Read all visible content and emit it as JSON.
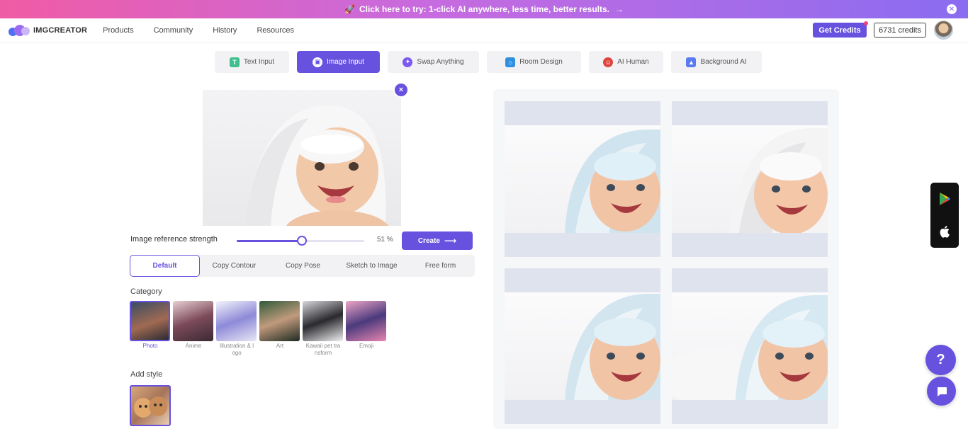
{
  "banner": {
    "text": "Click here to try: 1-click AI anywhere, less time, better results.",
    "arrow": "→",
    "close": "✕"
  },
  "nav": {
    "logo": "IMGCREATOR",
    "links": [
      "Products",
      "Community",
      "History",
      "Resources"
    ],
    "get_credits": "Get Credits",
    "credits": "6731 credits"
  },
  "tabs": [
    {
      "label": "Text Input",
      "icon": "text-icon",
      "glyph": "T"
    },
    {
      "label": "Image Input",
      "icon": "image-icon",
      "glyph": "▣"
    },
    {
      "label": "Swap Anything",
      "icon": "swap-icon",
      "glyph": "✦"
    },
    {
      "label": "Room Design",
      "icon": "house-icon",
      "glyph": "⌂"
    },
    {
      "label": "AI Human",
      "icon": "human-icon",
      "glyph": "☺"
    },
    {
      "label": "Background AI",
      "icon": "mountain-icon",
      "glyph": "▲"
    }
  ],
  "controls": {
    "strength_label": "Image reference strength",
    "strength_value": 51,
    "strength_text": "51 %",
    "create_label": "Create",
    "remove": "×"
  },
  "modes": [
    "Default",
    "Copy Contour",
    "Copy Pose",
    "Sketch to Image",
    "Free form"
  ],
  "category": {
    "label": "Category",
    "items": [
      "Photo",
      "Anime",
      "Illustration & l ogo",
      "Art",
      "Kawaii pet tra nsform",
      "Emoji"
    ]
  },
  "add_style": {
    "label": "Add style"
  },
  "colors": {
    "accent": "#6752e0",
    "banner_start": "#f05ba5",
    "banner_end": "#8a6cf0"
  },
  "floating": {
    "help": "?"
  }
}
